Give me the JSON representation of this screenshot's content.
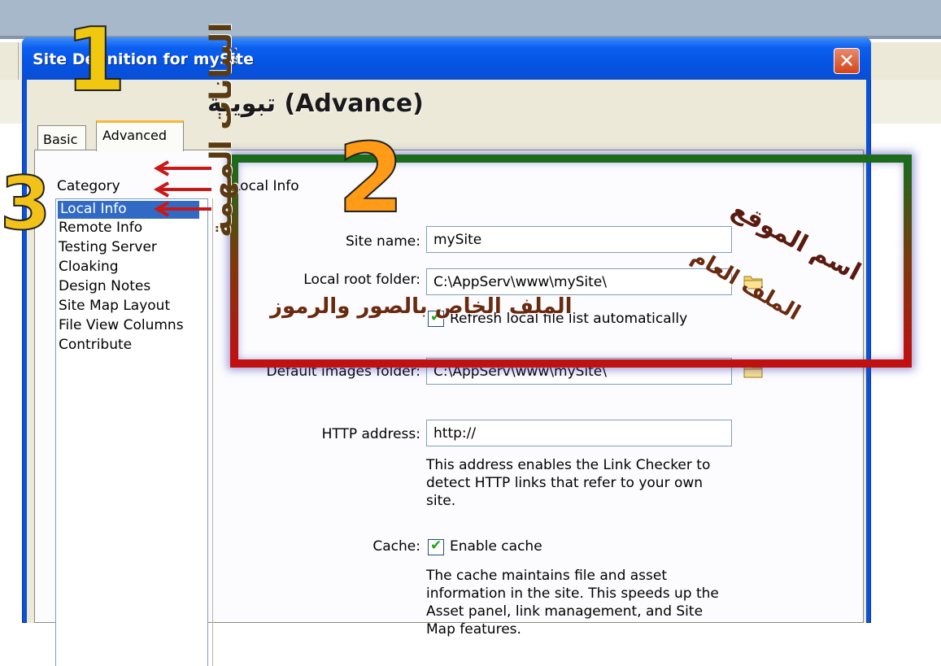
{
  "window": {
    "title": "Site Definition for mySite",
    "close_glyph": "✕"
  },
  "tabs": [
    {
      "label": "Basic"
    },
    {
      "label": "Advanced"
    }
  ],
  "category": {
    "title": "Category",
    "items": [
      "Local Info",
      "Remote Info",
      "Testing Server",
      "Cloaking",
      "Design Notes",
      "Site Map Layout",
      "File View Columns",
      "Contribute"
    ],
    "selected": "Local Info"
  },
  "local_info": {
    "title": "Local Info",
    "site_name_label": "Site name:",
    "site_name_value": "mySite",
    "local_root_label": "Local root folder:",
    "local_root_value": "C:\\AppServ\\www\\mySite\\",
    "refresh_label": "Refresh local file list automatically",
    "refresh_checked": true,
    "images_label": "Default images folder:",
    "images_value": "C:\\AppServ\\www\\mySite\\",
    "http_label": "HTTP address:",
    "http_value": "http://",
    "http_help": "This address enables the Link Checker to detect HTTP links that refer to your own site.",
    "cache_label": "Cache:",
    "cache_checkbox_label": "Enable cache",
    "cache_checked": true,
    "cache_help": "The cache maintains file and asset information in the site.  This speeds up the Asset panel, link management, and Site Map features."
  },
  "annotations": {
    "num1": "1",
    "num2": "2",
    "num3": "3",
    "advance_note": "تبويبة (Advance)",
    "site_name_note": "اسم الموقع",
    "root_note": "الملف العام",
    "images_note": "الملف الخاص بالصور والرموز",
    "side_note": "البيانات المهمة"
  },
  "colors": {
    "title_bar": "#0554e3",
    "selection": "#316ac5",
    "checkmark": "#21a121",
    "frame_top": "#1c6b1c",
    "frame_bottom": "#c01010"
  }
}
